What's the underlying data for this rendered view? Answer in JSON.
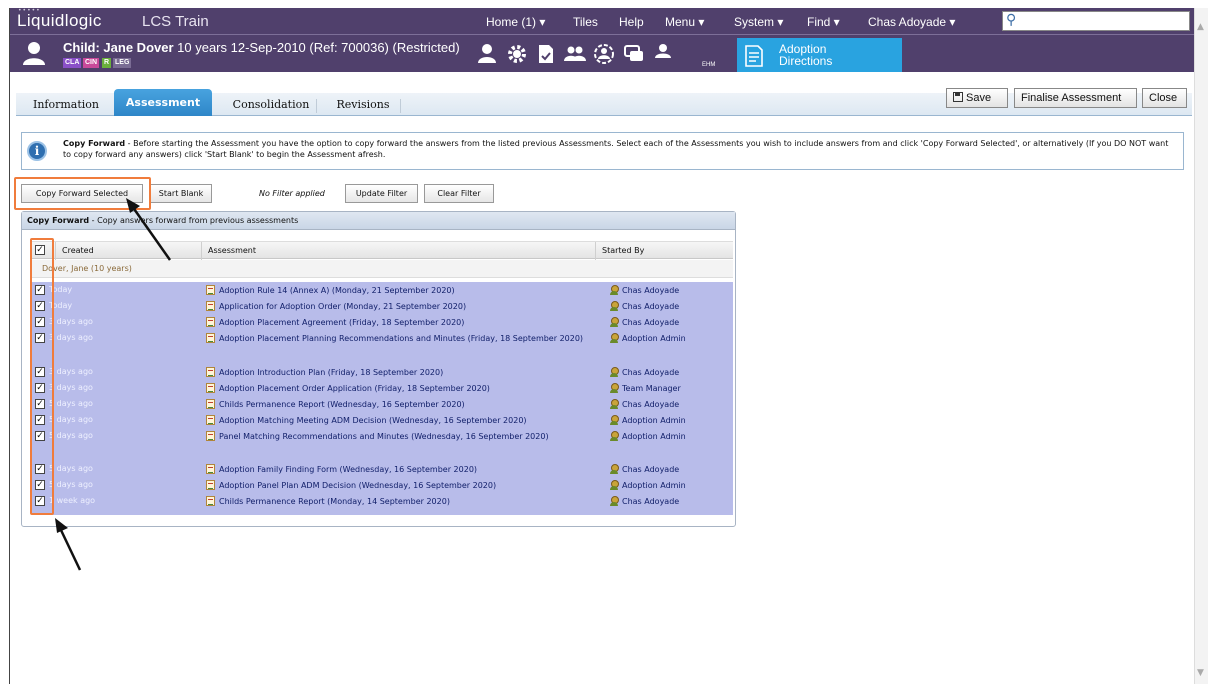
{
  "topbar": {
    "brand": "Liquidlogic",
    "app_name": "LCS Train",
    "nav": [
      {
        "label": "Home (1) ▾"
      },
      {
        "label": "Tiles"
      },
      {
        "label": "Help"
      },
      {
        "label": "Menu ▾"
      },
      {
        "label": "System ▾"
      },
      {
        "label": "Find ▾"
      },
      {
        "label": "Chas Adoyade ▾"
      }
    ],
    "search_placeholder": ""
  },
  "child": {
    "title_bold": "Child: Jane Dover",
    "title_rest": " 10 years 12-Sep-2010 (Ref: 700036) (Restricted)",
    "badges": [
      "CLA",
      "CIN",
      "R",
      "LEG"
    ],
    "ehm_label": "EHM"
  },
  "tile": {
    "label_line1": "Adoption",
    "label_line2": "Directions"
  },
  "tabs": [
    {
      "label": "Information"
    },
    {
      "label": "Assessment"
    },
    {
      "label": "Consolidation"
    },
    {
      "label": "Revisions"
    }
  ],
  "actions": {
    "save": "Save",
    "finalise": "Finalise Assessment",
    "close": "Close"
  },
  "info": {
    "bold": "Copy Forward",
    "text": " - Before starting the Assessment you have the option to copy forward the answers from the listed previous Assessments. Select each of the Assessments you wish to include answers from and click 'Copy Forward Selected', or alternatively (If you DO NOT want to copy forward any answers) click 'Start Blank' to begin the Assessment afresh."
  },
  "buttons": {
    "copy_forward": "Copy Forward Selected",
    "start_blank": "Start Blank",
    "filter_status": "No Filter applied",
    "update_filter": "Update Filter",
    "clear_filter": "Clear Filter"
  },
  "panel": {
    "title_bold": "Copy Forward",
    "title_rest": " - Copy answers forward from previous assessments",
    "columns": [
      "Created",
      "Assessment",
      "Started By"
    ],
    "group": "Dover, Jane (10 years)",
    "rows": [
      {
        "created": "Today",
        "assessment": "Adoption Rule 14 (Annex A) (Monday, 21 September 2020)",
        "started_by": "Chas Adoyade",
        "checked": true
      },
      {
        "created": "Today",
        "assessment": "Application for Adoption Order (Monday, 21 September 2020)",
        "started_by": "Chas Adoyade",
        "checked": true
      },
      {
        "created": "3 days ago",
        "assessment": "Adoption Placement Agreement (Friday, 18 September 2020)",
        "started_by": "Chas Adoyade",
        "checked": true
      },
      {
        "created": "3 days ago",
        "assessment": "Adoption Placement Planning Recommendations and Minutes (Friday, 18 September 2020)",
        "started_by": "Adoption Admin",
        "checked": true
      },
      {
        "created": "3 days ago",
        "assessment": "Adoption Introduction Plan (Friday, 18 September 2020)",
        "started_by": "Chas Adoyade",
        "checked": true
      },
      {
        "created": "3 days ago",
        "assessment": "Adoption Placement Order Application (Friday, 18 September 2020)",
        "started_by": "Team Manager",
        "checked": true
      },
      {
        "created": "5 days ago",
        "assessment": "Childs Permanence Report (Wednesday, 16 September 2020)",
        "started_by": "Chas Adoyade",
        "checked": true
      },
      {
        "created": "5 days ago",
        "assessment": "Adoption Matching Meeting ADM Decision (Wednesday, 16 September 2020)",
        "started_by": "Adoption Admin",
        "checked": true
      },
      {
        "created": "5 days ago",
        "assessment": "Panel Matching Recommendations and Minutes (Wednesday, 16 September 2020)",
        "started_by": "Adoption Admin",
        "checked": true
      },
      {
        "created": "5 days ago",
        "assessment": "Adoption Family Finding Form (Wednesday, 16 September 2020)",
        "started_by": "Chas Adoyade",
        "checked": true
      },
      {
        "created": "5 days ago",
        "assessment": "Adoption Panel Plan ADM Decision (Wednesday, 16 September 2020)",
        "started_by": "Adoption Admin",
        "checked": true
      },
      {
        "created": "1 week ago",
        "assessment": "Childs Permanence Report (Monday, 14 September 2020)",
        "started_by": "Chas Adoyade",
        "checked": true
      }
    ]
  },
  "colors": {
    "header": "#50406c",
    "tile": "#29a3e0",
    "tab_active": "#2e86c8",
    "row_selected": "#b8bcea",
    "annotation": "#f07c3c"
  }
}
